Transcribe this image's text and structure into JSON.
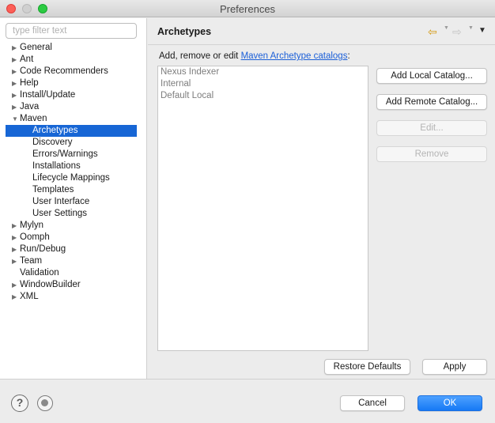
{
  "window": {
    "title": "Preferences"
  },
  "filter": {
    "placeholder": "type filter text"
  },
  "tree": {
    "items": [
      {
        "label": "General",
        "arrow": "▶",
        "child": false,
        "selected": false
      },
      {
        "label": "Ant",
        "arrow": "▶",
        "child": false,
        "selected": false
      },
      {
        "label": "Code Recommenders",
        "arrow": "▶",
        "child": false,
        "selected": false
      },
      {
        "label": "Help",
        "arrow": "▶",
        "child": false,
        "selected": false
      },
      {
        "label": "Install/Update",
        "arrow": "▶",
        "child": false,
        "selected": false
      },
      {
        "label": "Java",
        "arrow": "▶",
        "child": false,
        "selected": false
      },
      {
        "label": "Maven",
        "arrow": "▼",
        "child": false,
        "selected": false
      },
      {
        "label": "Archetypes",
        "arrow": "",
        "child": true,
        "selected": true
      },
      {
        "label": "Discovery",
        "arrow": "",
        "child": true,
        "selected": false
      },
      {
        "label": "Errors/Warnings",
        "arrow": "",
        "child": true,
        "selected": false
      },
      {
        "label": "Installations",
        "arrow": "",
        "child": true,
        "selected": false
      },
      {
        "label": "Lifecycle Mappings",
        "arrow": "",
        "child": true,
        "selected": false
      },
      {
        "label": "Templates",
        "arrow": "",
        "child": true,
        "selected": false
      },
      {
        "label": "User Interface",
        "arrow": "",
        "child": true,
        "selected": false
      },
      {
        "label": "User Settings",
        "arrow": "",
        "child": true,
        "selected": false
      },
      {
        "label": "Mylyn",
        "arrow": "▶",
        "child": false,
        "selected": false
      },
      {
        "label": "Oomph",
        "arrow": "▶",
        "child": false,
        "selected": false
      },
      {
        "label": "Run/Debug",
        "arrow": "▶",
        "child": false,
        "selected": false
      },
      {
        "label": "Team",
        "arrow": "▶",
        "child": false,
        "selected": false
      },
      {
        "label": "Validation",
        "arrow": "",
        "child": false,
        "selected": false
      },
      {
        "label": "WindowBuilder",
        "arrow": "▶",
        "child": false,
        "selected": false
      },
      {
        "label": "XML",
        "arrow": "▶",
        "child": false,
        "selected": false
      }
    ]
  },
  "page": {
    "title": "Archetypes",
    "description_prefix": "Add, remove or edit ",
    "description_link": "Maven Archetype catalogs",
    "description_suffix": ":",
    "catalogs": [
      "Nexus Indexer",
      "Internal",
      "Default Local"
    ]
  },
  "buttons": {
    "add_local": "Add Local Catalog...",
    "add_remote": "Add Remote Catalog...",
    "edit": "Edit...",
    "remove": "Remove",
    "restore_defaults": "Restore Defaults",
    "apply": "Apply",
    "cancel": "Cancel",
    "ok": "OK"
  },
  "icons": {
    "back": "back-arrow-icon",
    "forward": "forward-arrow-icon",
    "view_menu": "view-menu-icon",
    "help": "help-icon",
    "import": "import-export-icon"
  },
  "colors": {
    "selection": "#1766d5",
    "link": "#1b5fd8",
    "primary_button": "#1679f5"
  }
}
